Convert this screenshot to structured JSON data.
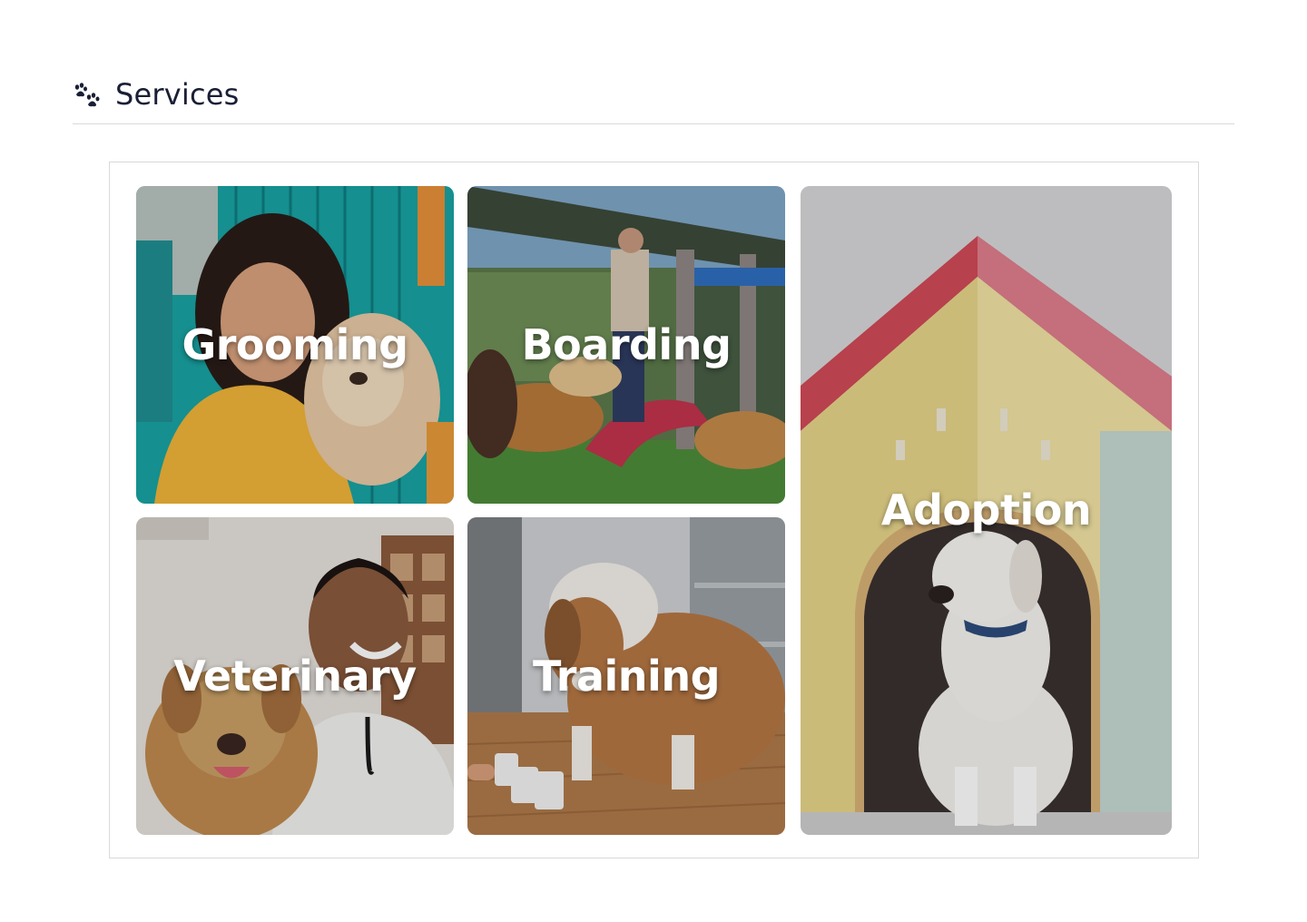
{
  "header": {
    "icon": "paw-prints-icon",
    "title": "Services"
  },
  "services": [
    {
      "label": "Grooming",
      "image": "woman-hugging-dog-photo"
    },
    {
      "label": "Boarding",
      "image": "dogs-playing-in-yard-photo"
    },
    {
      "label": "Veterinary",
      "image": "vet-with-dog-photo"
    },
    {
      "label": "Training",
      "image": "dog-training-with-cups-photo"
    },
    {
      "label": "Adoption",
      "image": "dog-in-doghouse-photo"
    }
  ],
  "colors": {
    "title_text": "#1a1f36",
    "divider": "#d9d9d9",
    "label_text": "#ffffff"
  }
}
